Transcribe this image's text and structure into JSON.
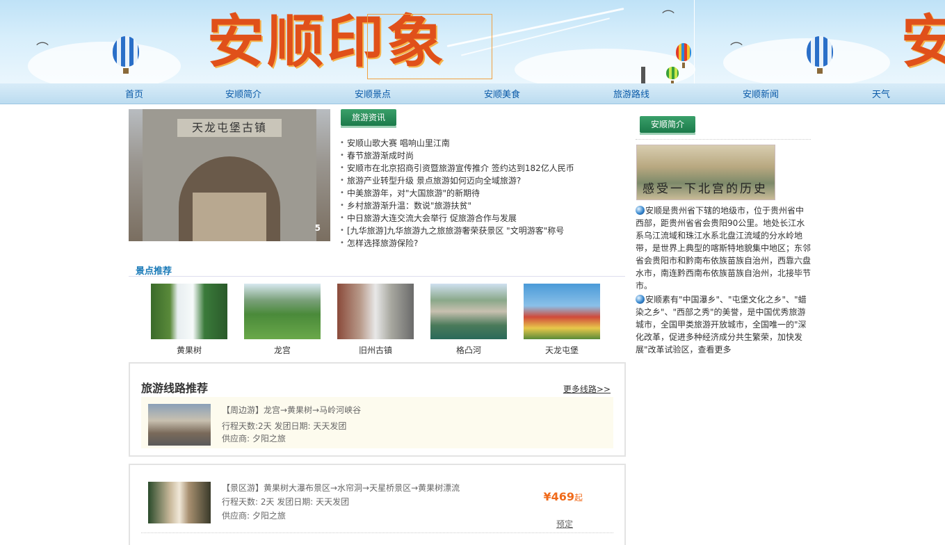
{
  "banner": {
    "title_part1": "安顺",
    "title_part2": "印象",
    "title_repeat": "安"
  },
  "nav": {
    "items": [
      "首页",
      "安顺简介",
      "安顺景点",
      "安顺美食",
      "旅游路线",
      "安顺新闻",
      "天气"
    ]
  },
  "slideshow": {
    "plaque": "天龙屯堡古镇",
    "index": "5"
  },
  "news": {
    "tab_label": "旅游资讯",
    "items": [
      "安顺山歌大赛 唱响山里江南",
      "春节旅游渐成时尚",
      "安顺市在北京招商引资暨旅游宣传推介 签约达到182亿人民币",
      "旅游产业转型升级 景点旅游如何迈向全域旅游?",
      "中美旅游年，对\"大国旅游\"的新期待",
      "乡村旅游渐升温：数说\"旅游扶贫\"",
      "中日旅游大连交流大会举行 促旅游合作与发展",
      "[九华旅游]九华旅游九之旅旅游奢荣获景区 \"文明游客\"称号",
      "怎样选择旅游保险?"
    ]
  },
  "spots": {
    "heading": "景点推荐",
    "items": [
      "黄果树",
      "龙宫",
      "旧州古镇",
      "格凸河",
      "天龙屯堡"
    ]
  },
  "routes": {
    "heading": "旅游线路推荐",
    "more": "更多线路>>",
    "items": [
      {
        "name": "【周边游】龙宫→黄果树→马岭河峡谷",
        "days": "行程天数:2天  发团日期: 天天发团",
        "supplier": "供应商: 夕阳之旅"
      },
      {
        "name": "【景区游】黄果树大瀑布景区→水帘洞→天星桥景区→黄果树漂流",
        "days": "行程天数: 2天  发团日期: 天天发团",
        "supplier": "供应商: 夕阳之旅",
        "price": "¥469",
        "price_suffix": "起",
        "book": "预定"
      }
    ]
  },
  "intro": {
    "tab_label": "安顺简介",
    "image_caption": "感受一下北宫的历史",
    "para1": "安顺是贵州省下辖的地级市，位于贵州省中西部，距贵州省省会贵阳90公里。地处长江水系乌江流域和珠江水系北盘江流域的分水岭地带，是世界上典型的喀斯特地貌集中地区；东邻省会贵阳市和黔南布依族苗族自治州，西靠六盘水市，南连黔西南布依族苗族自治州，北接毕节市。",
    "para2": "安顺素有\"中国瀑乡\"、\"屯堡文化之乡\"、\"蜡染之乡\"、\"西部之秀\"的美誉，是中国优秀旅游城市，全国甲类旅游开放城市，全国唯一的\"深化改革，促进多种经济成分共生繁荣，加快发展\"改革试验区，查看更多"
  },
  "colors": {
    "nav_link": "#0a5aa8",
    "tab_green": "#1b7a4a",
    "section_blue": "#1a7ab8",
    "price_orange": "#f06a1a"
  }
}
